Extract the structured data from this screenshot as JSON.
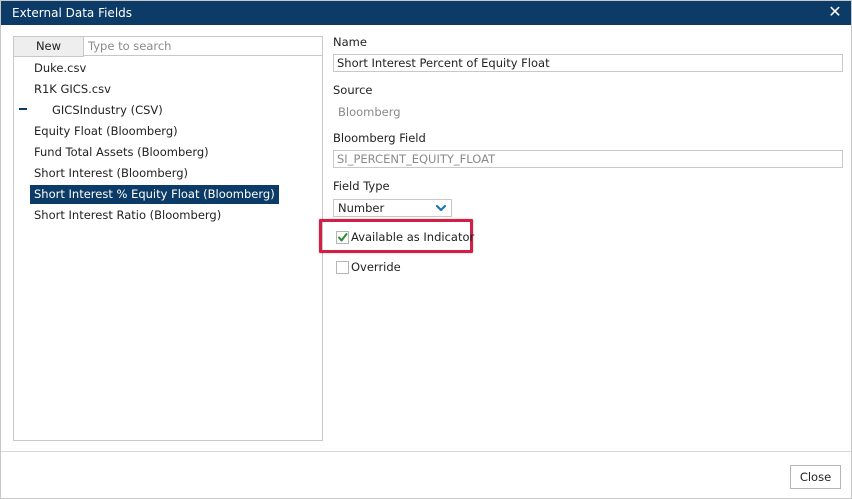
{
  "dialog": {
    "title": "External Data Fields",
    "close_icon": "close-icon",
    "close_button_label": "Close"
  },
  "left": {
    "new_label": "New",
    "search_placeholder": "Type to search",
    "items": [
      {
        "label": "Duke.csv"
      },
      {
        "label": "R1K GICS.csv",
        "expanded": true
      },
      {
        "label": "GICSIndustry (CSV)",
        "child": true
      },
      {
        "label": "Equity Float (Bloomberg)"
      },
      {
        "label": "Fund Total Assets (Bloomberg)"
      },
      {
        "label": "Short Interest (Bloomberg)"
      },
      {
        "label": "Short Interest % Equity Float (Bloomberg)",
        "selected": true
      },
      {
        "label": "Short Interest Ratio (Bloomberg)"
      }
    ]
  },
  "details": {
    "name_label": "Name",
    "name_value": "Short Interest Percent of Equity Float",
    "source_label": "Source",
    "source_value": "Bloomberg",
    "bloomberg_field_label": "Bloomberg Field",
    "bloomberg_field_value": "SI_PERCENT_EQUITY_FLOAT",
    "field_type_label": "Field Type",
    "field_type_value": "Number",
    "available_label": "Available as Indicator",
    "available_checked": true,
    "override_label": "Override",
    "override_checked": false
  },
  "colors": {
    "titlebar": "#0b3b66",
    "selected_row": "#0b3b66",
    "highlight": "#d31f45",
    "check": "#2e8b2e",
    "chevron": "#1a75b8"
  }
}
